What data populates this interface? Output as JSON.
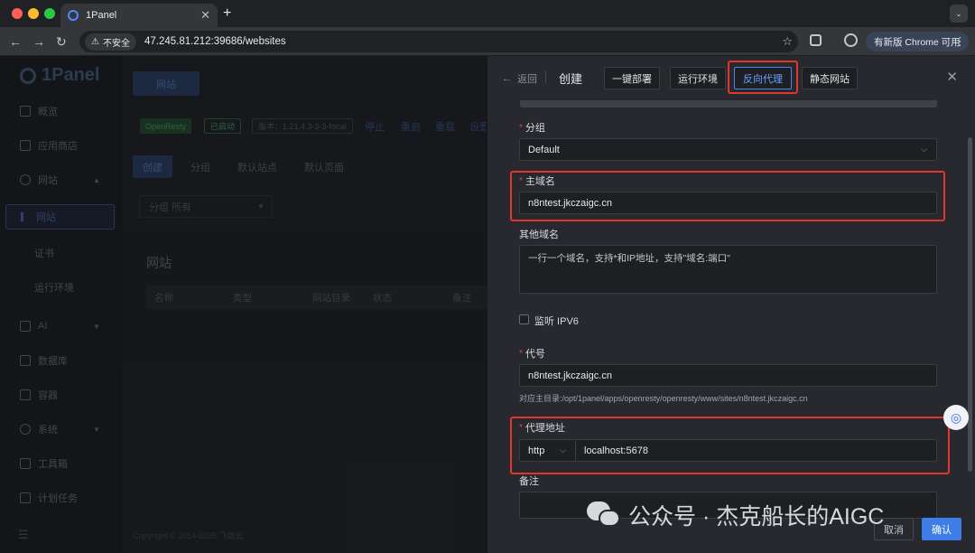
{
  "browser": {
    "tab_title": "1Panel",
    "security_label": "不安全",
    "url": "47.245.81.212:39686/websites",
    "update_label": "有新版 Chrome 可用"
  },
  "sidebar": {
    "logo": "1Panel",
    "items": [
      {
        "label": "概览"
      },
      {
        "label": "应用商店"
      },
      {
        "label": "网站"
      },
      {
        "label": "网站"
      },
      {
        "label": "证书"
      },
      {
        "label": "运行环境"
      },
      {
        "label": "AI"
      },
      {
        "label": "数据库"
      },
      {
        "label": "容器"
      },
      {
        "label": "系统"
      },
      {
        "label": "工具箱"
      },
      {
        "label": "计划任务"
      }
    ],
    "copyright": "Copyright © 2014-2025 飞致云"
  },
  "main": {
    "top_tab": "网站",
    "openresty_tag": "OpenResty",
    "status_tag": "已启动",
    "version_tag": "版本：1.21.4.3-3-3-focal",
    "actions": [
      "停止",
      "重启",
      "重载",
      "设置"
    ],
    "subtabs": [
      "创建",
      "分组",
      "默认站点",
      "默认页面"
    ],
    "filter": "分组  所有",
    "card_title": "网站",
    "columns": [
      "名称",
      "类型",
      "网站目录",
      "状态",
      "备注"
    ]
  },
  "drawer": {
    "back_label": "返回",
    "title": "创建",
    "tabs": [
      "一键部署",
      "运行环境",
      "反向代理",
      "静态网站"
    ],
    "active_tab": "反向代理",
    "group_label": "分组",
    "group_value": "Default",
    "primary_domain_label": "主域名",
    "primary_domain_value": "n8ntest.jkczaigc.cn",
    "other_domains_label": "其他域名",
    "other_domains_placeholder": "一行一个域名，支持*和IP地址，支持\"域名:端口\"",
    "ipv6_label": "监听 IPV6",
    "alias_label": "代号",
    "alias_value": "n8ntest.jkczaigc.cn",
    "alias_hint": "对应主目录:/opt/1panel/apps/openresty/openresty/www/sites/n8ntest.jkczaigc.cn",
    "proxy_label": "代理地址",
    "proxy_protocol": "http",
    "proxy_address": "localhost:5678",
    "remark_label": "备注",
    "cancel_label": "取消",
    "confirm_label": "确认"
  },
  "watermark": "公众号 · 杰克船长的AIGC",
  "colors": {
    "accent": "#4b82f0",
    "highlight": "#e0362b",
    "required": "#e0453a"
  }
}
